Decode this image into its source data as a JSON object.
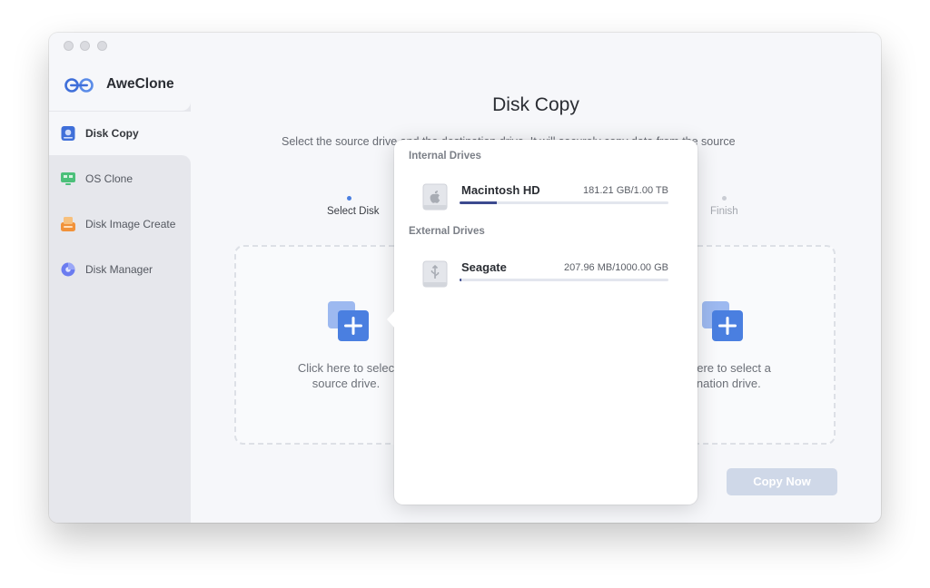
{
  "app": {
    "name": "AweClone"
  },
  "sidebar": {
    "items": [
      {
        "label": "Disk Copy",
        "icon": "disk-copy-icon",
        "active": true
      },
      {
        "label": "OS Clone",
        "icon": "os-clone-icon",
        "active": false
      },
      {
        "label": "Disk Image Create",
        "icon": "disk-image-icon",
        "active": false
      },
      {
        "label": "Disk Manager",
        "icon": "disk-manager-icon",
        "active": false
      }
    ]
  },
  "main": {
    "title": "Disk Copy",
    "subtitle": "Select the source drive and the destination drive. It will securely copy data from the source",
    "steps": [
      {
        "label": "Select Disk",
        "state": "active"
      },
      {
        "label": "Finish",
        "state": "pending"
      }
    ],
    "source_zone": {
      "text_line1": "Click here to selec",
      "text_line2": "source drive."
    },
    "dest_zone": {
      "text_line1": "here to select a",
      "text_line2": "ination drive."
    },
    "copy_button": "Copy Now"
  },
  "drive_popover": {
    "internal_header": "Internal Drives",
    "external_header": "External Drives",
    "internal": [
      {
        "name": "Macintosh HD",
        "size": "181.21 GB/1.00 TB",
        "used_fraction": 0.18,
        "icon": "apple-drive-icon"
      }
    ],
    "external": [
      {
        "name": "Seagate",
        "size": "207.96 MB/1000.00 GB",
        "used_fraction": 0.01,
        "icon": "usb-drive-icon"
      }
    ]
  },
  "colors": {
    "accent": "#4a7fe0",
    "progress": "#3c4a8f",
    "button_disabled": "#cfd8e8"
  }
}
